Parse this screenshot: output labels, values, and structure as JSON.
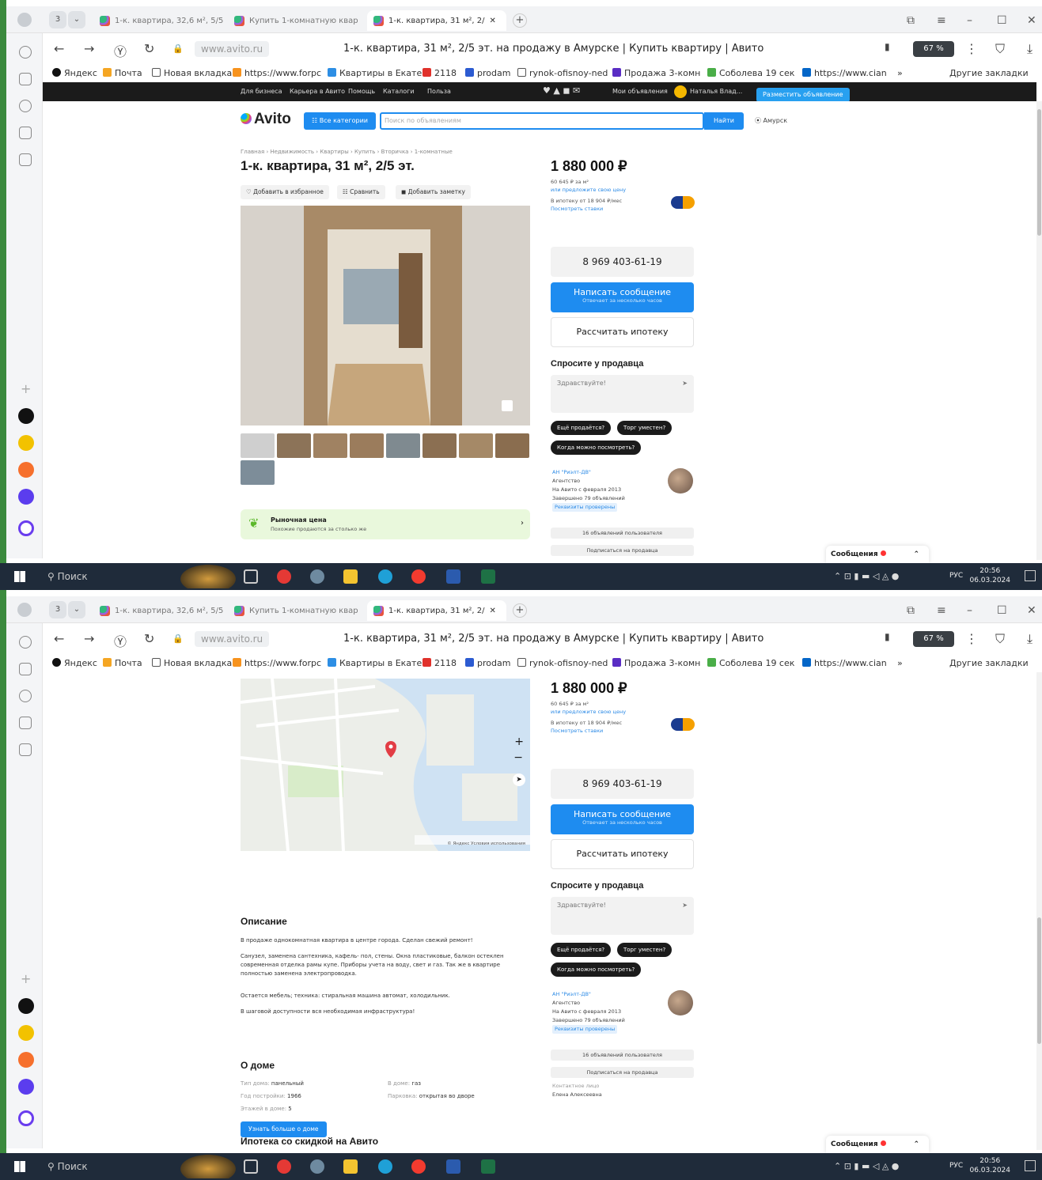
{
  "browser": {
    "tab_count": "3",
    "tabs": [
      {
        "label": "1-к. квартира, 32,6 м², 5/5"
      },
      {
        "label": "Купить 1-комнатную квар"
      },
      {
        "label": "1-к. квартира, 31 м², 2/"
      }
    ],
    "url": "www.avito.ru",
    "page_title": "1-к. квартира, 31 м², 2/5 эт. на продажу в Амурске | Купить квартиру | Авито",
    "zoom": "67 %",
    "bookmarks": [
      "Яндекс",
      "Почта",
      "Новая вкладка",
      "https://www.forpc",
      "Квартиры в Екате",
      "2118",
      "prodam",
      "rynok-ofisnoy-ned",
      "Продажа 3-комн",
      "Соболева 19 сек",
      "https://www.cian",
      "Другие закладки"
    ]
  },
  "avito_topnav": {
    "links": [
      "Для бизнеса",
      "Карьера в Авито",
      "Помощь",
      "Каталоги",
      "Польза"
    ],
    "my_ads": "Мои объявления",
    "user": "Наталья Влад...",
    "post_ad": "Разместить объявление"
  },
  "header": {
    "logo": "Avito",
    "all_categories": "Все категории",
    "search_placeholder": "Поиск по объявлениям",
    "find": "Найти",
    "city": "Амурск"
  },
  "listing": {
    "breadcrumbs": "Главная › Недвижимость › Квартиры › Купить › Вторичка › 1-комнатные",
    "title": "1-к. квартира, 31 м², 2/5 эт.",
    "actions": {
      "favorite": "Добавить в избранное",
      "compare": "Сравнить",
      "note": "Добавить заметку"
    },
    "market_price_title": "Рыночная цена",
    "market_price_sub": "Похожие продаются за столько же"
  },
  "sidebar": {
    "price": "1 880 000 ₽",
    "price_per_m2": "60 645 ₽ за м²",
    "offer_price": "или предложите свою цену",
    "mortgage_from": "В ипотеку от 18 904 ₽/мес",
    "view_offers": "Посмотреть ставки",
    "phone": "8 969 403-61-19",
    "write_message": "Написать сообщение",
    "write_message_sub": "Отвечает за несколько часов",
    "calc_mortgage": "Рассчитать ипотеку",
    "ask_seller": "Спросите у продавца",
    "ask_placeholder": "Здравствуйте!",
    "chips": [
      "Ещё продаётся?",
      "Торг уместен?",
      "Когда можно посмотреть?"
    ],
    "seller_name": "АН \"Риэлт-ДВ\"",
    "seller_type": "Агентство",
    "seller_since": "На Авито с февраля 2013",
    "seller_done": "Завершено 79 объявлений",
    "seller_badge": "Реквизиты проверены",
    "seller_ads": "16 объявлений пользователя",
    "subscribe": "Подписаться на продавца",
    "contact_label": "Контактное лицо",
    "contact_name": "Елена Алексеевна"
  },
  "chat": {
    "label": "Сообщения"
  },
  "description": {
    "heading": "Описание",
    "p1": "В продаже однокомнатная квартира в центре города. Сделан свежий ремонт!",
    "p2": "Санузел, заменена сантехника, кафель- пол, стены. Окна пластиковые, балкон остеклен современная отделка рамы купе. Приборы учета на воду, свет и газ. Так же в квартире полностью заменена электропроводка.",
    "p3": "Остается мебель; техника: стиральная машина автомат, холодильник.",
    "p4": "В шаговой доступности вся необходимая инфраструктура!"
  },
  "house": {
    "heading": "О доме",
    "type_k": "Тип дома: ",
    "type_v": "панельный",
    "year_k": "Год постройки: ",
    "year_v": "1966",
    "floors_k": "Этажей в доме: ",
    "floors_v": "5",
    "in_house_k": "В доме: ",
    "in_house_v": "газ",
    "parking_k": "Парковка: ",
    "parking_v": "открытая во дворе",
    "more": "Узнать больше о доме"
  },
  "map": {
    "attribution": "© Яндекс Условия использования"
  },
  "mortgage_section": "Ипотека со скидкой на Авито",
  "taskbar": {
    "search": "Поиск",
    "lang": "РУС",
    "time": "20:56",
    "date": "06.03.2024"
  },
  "colors": {
    "accent": "#1e8cf0",
    "topnav": "#1b1b1b",
    "taskbar": "#1f2b3a",
    "market": "#e9f8dc"
  }
}
